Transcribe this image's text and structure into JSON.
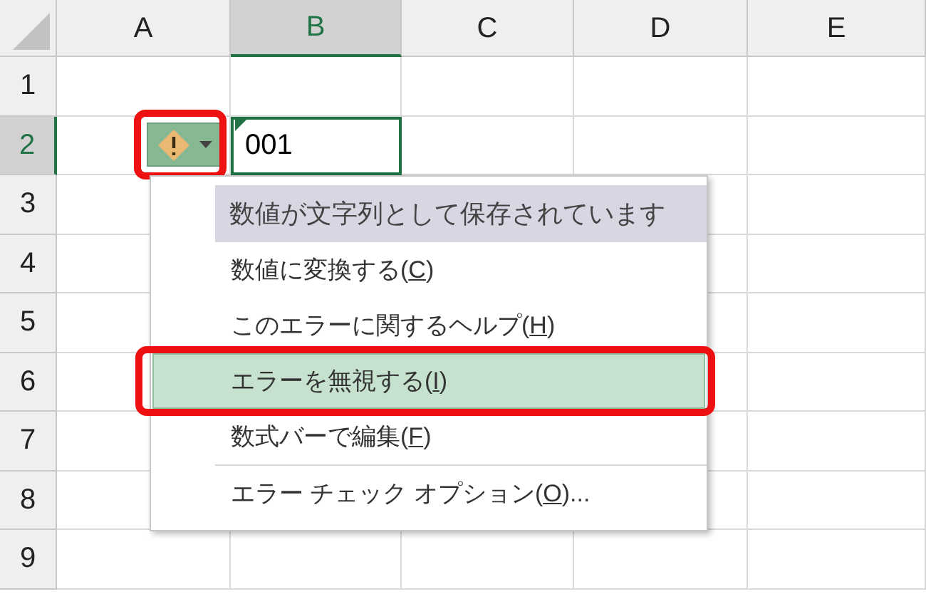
{
  "columns": [
    {
      "label": "A",
      "selected": false
    },
    {
      "label": "B",
      "selected": true
    },
    {
      "label": "C",
      "selected": false
    },
    {
      "label": "D",
      "selected": false
    },
    {
      "label": "E",
      "selected": false
    }
  ],
  "rows": [
    {
      "label": "1",
      "selected": false
    },
    {
      "label": "2",
      "selected": true
    },
    {
      "label": "3",
      "selected": false
    },
    {
      "label": "4",
      "selected": false
    },
    {
      "label": "5",
      "selected": false
    },
    {
      "label": "6",
      "selected": false
    },
    {
      "label": "7",
      "selected": false
    },
    {
      "label": "8",
      "selected": false
    },
    {
      "label": "9",
      "selected": false
    }
  ],
  "active_cell": {
    "value": "001",
    "error_indicator": true
  },
  "error_button": {
    "annotated": true
  },
  "error_menu": {
    "title": "数値が文字列として保存されています",
    "items": [
      {
        "before": "数値に変換する(",
        "key": "C",
        "after": ")",
        "selected": false,
        "annotated": false,
        "separator_before": false
      },
      {
        "before": "このエラーに関するヘルプ(",
        "key": "H",
        "after": ")",
        "selected": false,
        "annotated": false,
        "separator_before": false
      },
      {
        "before": "エラーを無視する(",
        "key": "I",
        "after": ")",
        "selected": true,
        "annotated": true,
        "separator_before": false
      },
      {
        "before": "数式バーで編集(",
        "key": "F",
        "after": ")",
        "selected": false,
        "annotated": false,
        "separator_before": false
      },
      {
        "before": "エラー チェック オプション(",
        "key": "O",
        "after": ")...",
        "selected": false,
        "annotated": false,
        "separator_before": true
      }
    ]
  }
}
